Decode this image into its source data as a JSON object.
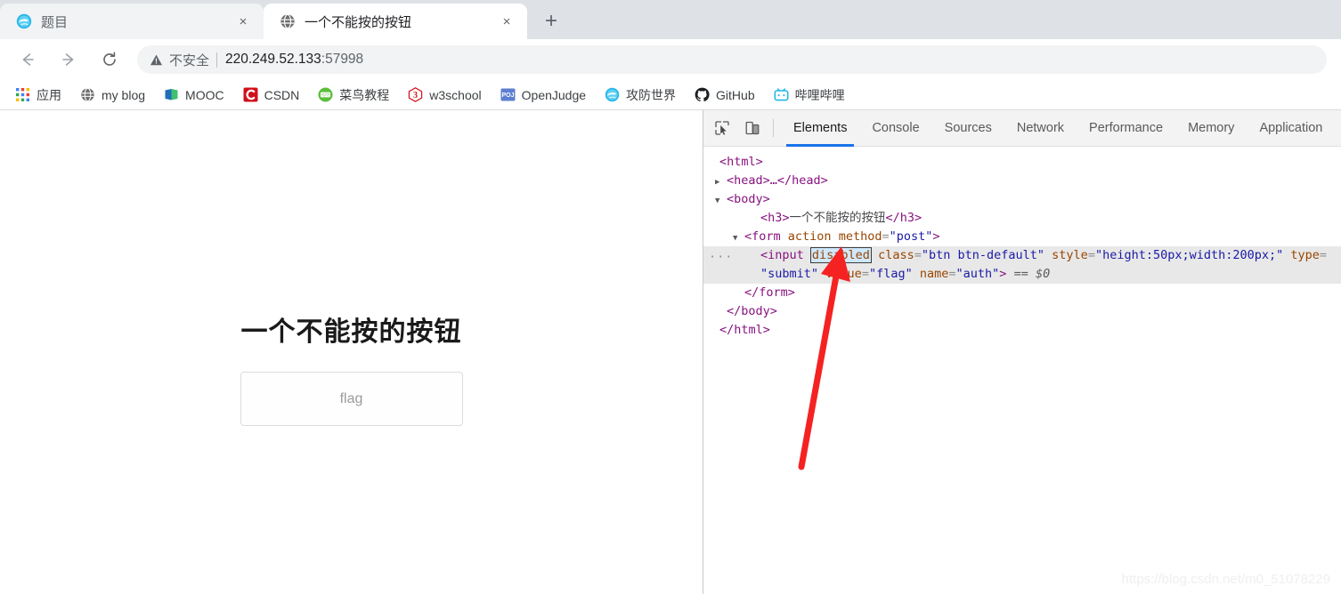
{
  "browser": {
    "tabs": [
      {
        "title": "题目",
        "favicon": "xctf-globe-icon",
        "active": false,
        "close_label": "×"
      },
      {
        "title": "一个不能按的按钮",
        "favicon": "default-globe-icon",
        "active": true,
        "close_label": "×"
      }
    ],
    "new_tab_label": "+",
    "nav": {
      "back_label": "←",
      "forward_label": "→",
      "reload_label": "⟳"
    },
    "omnibox": {
      "security_icon": "warning-triangle-icon",
      "security_text": "不安全",
      "separator": "|",
      "url_host": "220.249.52.133",
      "url_port": ":57998"
    },
    "bookmarks": [
      {
        "label": "应用",
        "icon": "apps-grid-icon"
      },
      {
        "label": "my blog",
        "icon": "globe-icon"
      },
      {
        "label": "MOOC",
        "icon": "mooc-book-icon"
      },
      {
        "label": "CSDN",
        "icon": "csdn-c-icon"
      },
      {
        "label": "菜鸟教程",
        "icon": "runoob-code-icon"
      },
      {
        "label": "w3school",
        "icon": "w3school-3-icon"
      },
      {
        "label": "OpenJudge",
        "icon": "poj-icon"
      },
      {
        "label": "攻防世界",
        "icon": "xctf-globe-icon"
      },
      {
        "label": "GitHub",
        "icon": "github-cat-icon"
      },
      {
        "label": "哔哩哔哩",
        "icon": "bilibili-tv-icon"
      }
    ]
  },
  "page": {
    "heading": "一个不能按的按钮",
    "button_label": "flag"
  },
  "devtools": {
    "toolbar_icons": [
      {
        "name": "inspect-element-icon"
      },
      {
        "name": "device-toolbar-icon"
      }
    ],
    "tabs": [
      {
        "label": "Elements",
        "active": true
      },
      {
        "label": "Console",
        "active": false
      },
      {
        "label": "Sources",
        "active": false
      },
      {
        "label": "Network",
        "active": false
      },
      {
        "label": "Performance",
        "active": false
      },
      {
        "label": "Memory",
        "active": false
      },
      {
        "label": "Application",
        "active": false
      }
    ],
    "dom": {
      "l1_html_open": "<html>",
      "l2_head": "<head>…</head>",
      "l2_triangle": "▶",
      "l3_body_open": "<body>",
      "l3_triangle": "▼",
      "l4_h3_open": "<h3>",
      "l4_h3_text": "一个不能按的按钮",
      "l4_h3_close": "</h3>",
      "l5_triangle": "▼",
      "l5_form_open_a": "<form ",
      "l5_form_attr_action": "action",
      "l5_form_attr_method": "method",
      "l5_form_method_value": "\"post\"",
      "l5_form_open_b": ">",
      "sel_dots": "···",
      "sel_input_open": "<input ",
      "sel_attr_disabled": "disabled",
      "sel_attr_class_n": " class",
      "sel_attr_class_v": "\"btn btn-default\"",
      "sel_attr_style_n": " style",
      "sel_attr_style_v": "\"height:50px;width:200px;\"",
      "sel_attr_type_n": " type",
      "sel_attr_type_v": "\"submit\"",
      "sel_attr_value_n": " value",
      "sel_attr_value_v": "\"flag\"",
      "sel_attr_name_n": " name",
      "sel_attr_name_v": "\"auth\"",
      "sel_close": ">",
      "sel_ref": "== $0",
      "l7_form_close": "</form>",
      "l8_body_close": "</body>",
      "l9_html_close": "</html>",
      "eq": "=",
      "tag_open_gt": ">"
    },
    "annotation": {
      "arrow": "red-arrow-pointing-to-disabled-attribute"
    }
  },
  "watermark": "https://blog.csdn.net/m0_51078229",
  "colors": {
    "accent": "#1a73e8",
    "tabstrip_bg": "#dee1e6",
    "selected_row_bg": "#e8e8e8",
    "attr_highlight": "#cfe8fc",
    "arrow_red": "#f52222",
    "tag_purple": "#881280",
    "attr_name_orange": "#994500",
    "attr_value_blue": "#1a1aa6"
  }
}
